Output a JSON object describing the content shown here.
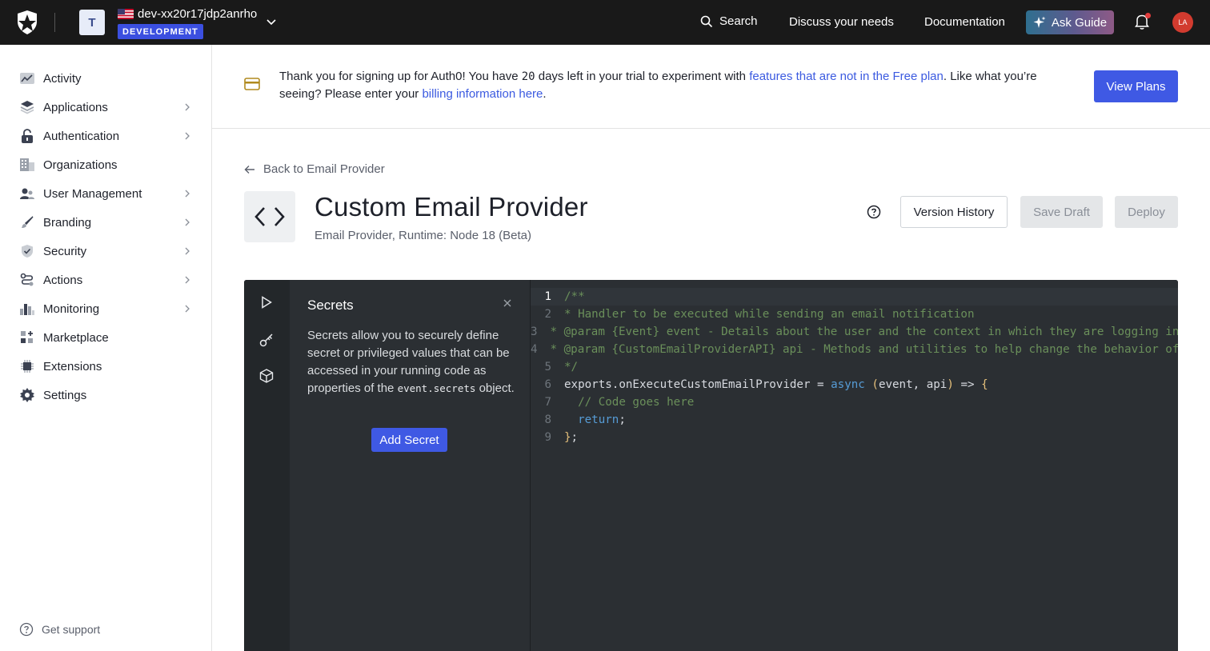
{
  "topbar": {
    "tenant_initial": "T",
    "tenant_name": "dev-xx20r17jdp2anrho",
    "environment": "DEVELOPMENT",
    "search_label": "Search",
    "links": [
      "Discuss your needs",
      "Documentation"
    ],
    "ask_guide_label": "Ask Guide",
    "user_initials": "LA",
    "notification_dot": true
  },
  "sidebar": {
    "items": [
      {
        "label": "Activity",
        "icon": "activity-chart-icon",
        "has_chevron": false
      },
      {
        "label": "Applications",
        "icon": "layers-icon",
        "has_chevron": true
      },
      {
        "label": "Authentication",
        "icon": "lock-icon",
        "has_chevron": true
      },
      {
        "label": "Organizations",
        "icon": "building-icon",
        "has_chevron": false
      },
      {
        "label": "User Management",
        "icon": "users-icon",
        "has_chevron": true
      },
      {
        "label": "Branding",
        "icon": "brush-icon",
        "has_chevron": true
      },
      {
        "label": "Security",
        "icon": "shield-icon",
        "has_chevron": true
      },
      {
        "label": "Actions",
        "icon": "flow-icon",
        "has_chevron": true
      },
      {
        "label": "Monitoring",
        "icon": "bar-chart-icon",
        "has_chevron": true
      },
      {
        "label": "Marketplace",
        "icon": "grid-plus-icon",
        "has_chevron": false
      },
      {
        "label": "Extensions",
        "icon": "chip-icon",
        "has_chevron": false
      },
      {
        "label": "Settings",
        "icon": "gear-icon",
        "has_chevron": false
      }
    ],
    "support_label": "Get support"
  },
  "banner": {
    "text_1": "Thank you for signing up for Auth0! You have ",
    "days": "20",
    "text_2": " days left in your trial to experiment with ",
    "link_1": "features that are not in the Free plan",
    "text_3": ". Like what you’re seeing? Please enter your ",
    "link_2": "billing information here",
    "text_4": ".",
    "button_label": "View Plans"
  },
  "page": {
    "back_label": "Back to Email Provider",
    "title": "Custom Email Provider",
    "subtitle": "Email Provider, Runtime: Node 18 (Beta)",
    "version_history_label": "Version History",
    "save_draft_label": "Save Draft",
    "deploy_label": "Deploy"
  },
  "secrets_panel": {
    "title": "Secrets",
    "description_1": "Secrets allow you to securely define secret or privileged values that can be accessed in your running code as properties of the ",
    "code_term": "event.secrets",
    "description_2": " object.",
    "button_label": "Add Secret"
  },
  "code": {
    "lines": [
      [
        {
          "t": "/**",
          "c": "comment"
        }
      ],
      [
        {
          "t": "* Handler to be executed while sending an email notification",
          "c": "comment"
        }
      ],
      [
        {
          "t": "* @param {Event} event - Details about the user and the context in which they are logging in",
          "c": "comment"
        }
      ],
      [
        {
          "t": "* @param {CustomEmailProviderAPI} api - Methods and utilities to help change the behavior of",
          "c": "comment"
        }
      ],
      [
        {
          "t": "*/",
          "c": "comment"
        }
      ],
      [
        {
          "t": "exports.onExecuteCustomEmailProvider = ",
          "c": "plain"
        },
        {
          "t": "async",
          "c": "kw"
        },
        {
          "t": " ",
          "c": "plain"
        },
        {
          "t": "(",
          "c": "brace"
        },
        {
          "t": "event, api",
          "c": "plain"
        },
        {
          "t": ")",
          "c": "brace"
        },
        {
          "t": " => ",
          "c": "plain"
        },
        {
          "t": "{",
          "c": "brace"
        }
      ],
      [
        {
          "t": "  // Code goes here",
          "c": "comment"
        }
      ],
      [
        {
          "t": "  ",
          "c": "plain"
        },
        {
          "t": "return",
          "c": "kw"
        },
        {
          "t": ";",
          "c": "plain"
        }
      ],
      [
        {
          "t": "}",
          "c": "brace"
        },
        {
          "t": ";",
          "c": "plain"
        }
      ]
    ],
    "active_line": 1
  }
}
